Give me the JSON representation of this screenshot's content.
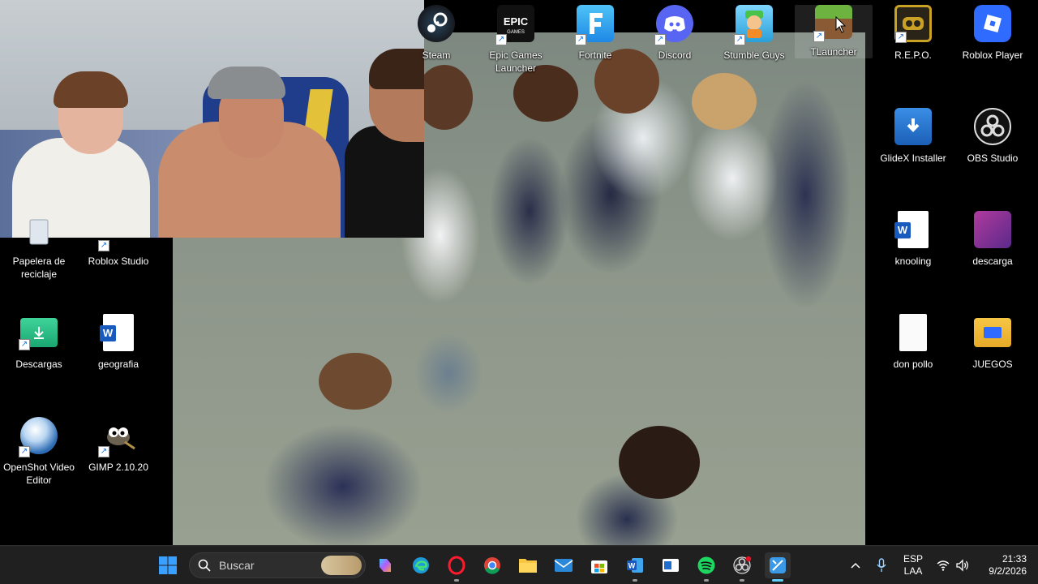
{
  "desktop": {
    "icons_top": [
      {
        "key": "steam",
        "label": "Steam",
        "icon": "steam-icon",
        "color": "#1b2838"
      },
      {
        "key": "epic",
        "label": "Epic Games Launcher",
        "icon": "epic-games-icon",
        "color": "#111111"
      },
      {
        "key": "fortnite",
        "label": "Fortnite",
        "icon": "fortnite-icon",
        "color": "#2aa9e0"
      },
      {
        "key": "discord",
        "label": "Discord",
        "icon": "discord-icon",
        "color": "#5865f2"
      },
      {
        "key": "stumble",
        "label": "Stumble Guys",
        "icon": "stumble-guys-icon",
        "color": "#3fb6f0"
      },
      {
        "key": "tlauncher",
        "label": "TLauncher",
        "icon": "tlauncher-icon",
        "color": "#5b8c2a"
      },
      {
        "key": "repo",
        "label": "R.E.P.O.",
        "icon": "repo-icon",
        "color": "#c9a125"
      },
      {
        "key": "roblox",
        "label": "Roblox Player",
        "icon": "roblox-icon",
        "color": "#2f6bff"
      }
    ],
    "icons_right": [
      {
        "key": "glidex",
        "label": "GlideX Installer",
        "icon": "glidex-installer-icon"
      },
      {
        "key": "obs",
        "label": "OBS Studio",
        "icon": "obs-studio-icon"
      },
      {
        "key": "knooling",
        "label": "knooling",
        "icon": "word-document-icon"
      },
      {
        "key": "descarga",
        "label": "descarga",
        "icon": "image-file-icon"
      },
      {
        "key": "donpollo",
        "label": "don pollo",
        "icon": "blank-file-icon"
      },
      {
        "key": "juegos",
        "label": "JUEGOS",
        "icon": "folder-icon"
      }
    ],
    "icons_left": [
      {
        "key": "papelera",
        "label": "Papelera de reciclaje",
        "icon": "recycle-bin-icon"
      },
      {
        "key": "robloxstudio",
        "label": "Roblox Studio",
        "icon": "roblox-studio-icon"
      },
      {
        "key": "descargas",
        "label": "Descargas",
        "icon": "downloads-folder-icon"
      },
      {
        "key": "geografia",
        "label": "geografia",
        "icon": "word-document-icon"
      },
      {
        "key": "openshot",
        "label": "OpenShot Video Editor",
        "icon": "openshot-icon"
      },
      {
        "key": "gimp",
        "label": "GIMP 2.10.20",
        "icon": "gimp-icon"
      }
    ]
  },
  "taskbar": {
    "search_placeholder": "Buscar",
    "apps": [
      {
        "icon": "start-windows-icon"
      },
      {
        "icon": "copilot-icon"
      },
      {
        "icon": "edge-icon"
      },
      {
        "icon": "opera-icon"
      },
      {
        "icon": "chrome-icon"
      },
      {
        "icon": "file-explorer-icon"
      },
      {
        "icon": "mail-icon"
      },
      {
        "icon": "microsoft-store-icon"
      },
      {
        "icon": "word-icon"
      },
      {
        "icon": "generic-app-icon"
      },
      {
        "icon": "spotify-icon"
      },
      {
        "icon": "obs-icon"
      },
      {
        "icon": "snipping-tool-icon"
      }
    ],
    "tray": {
      "language": "ESP",
      "layout": "LAA",
      "time": "21:33",
      "date": "9/2/2026"
    }
  }
}
